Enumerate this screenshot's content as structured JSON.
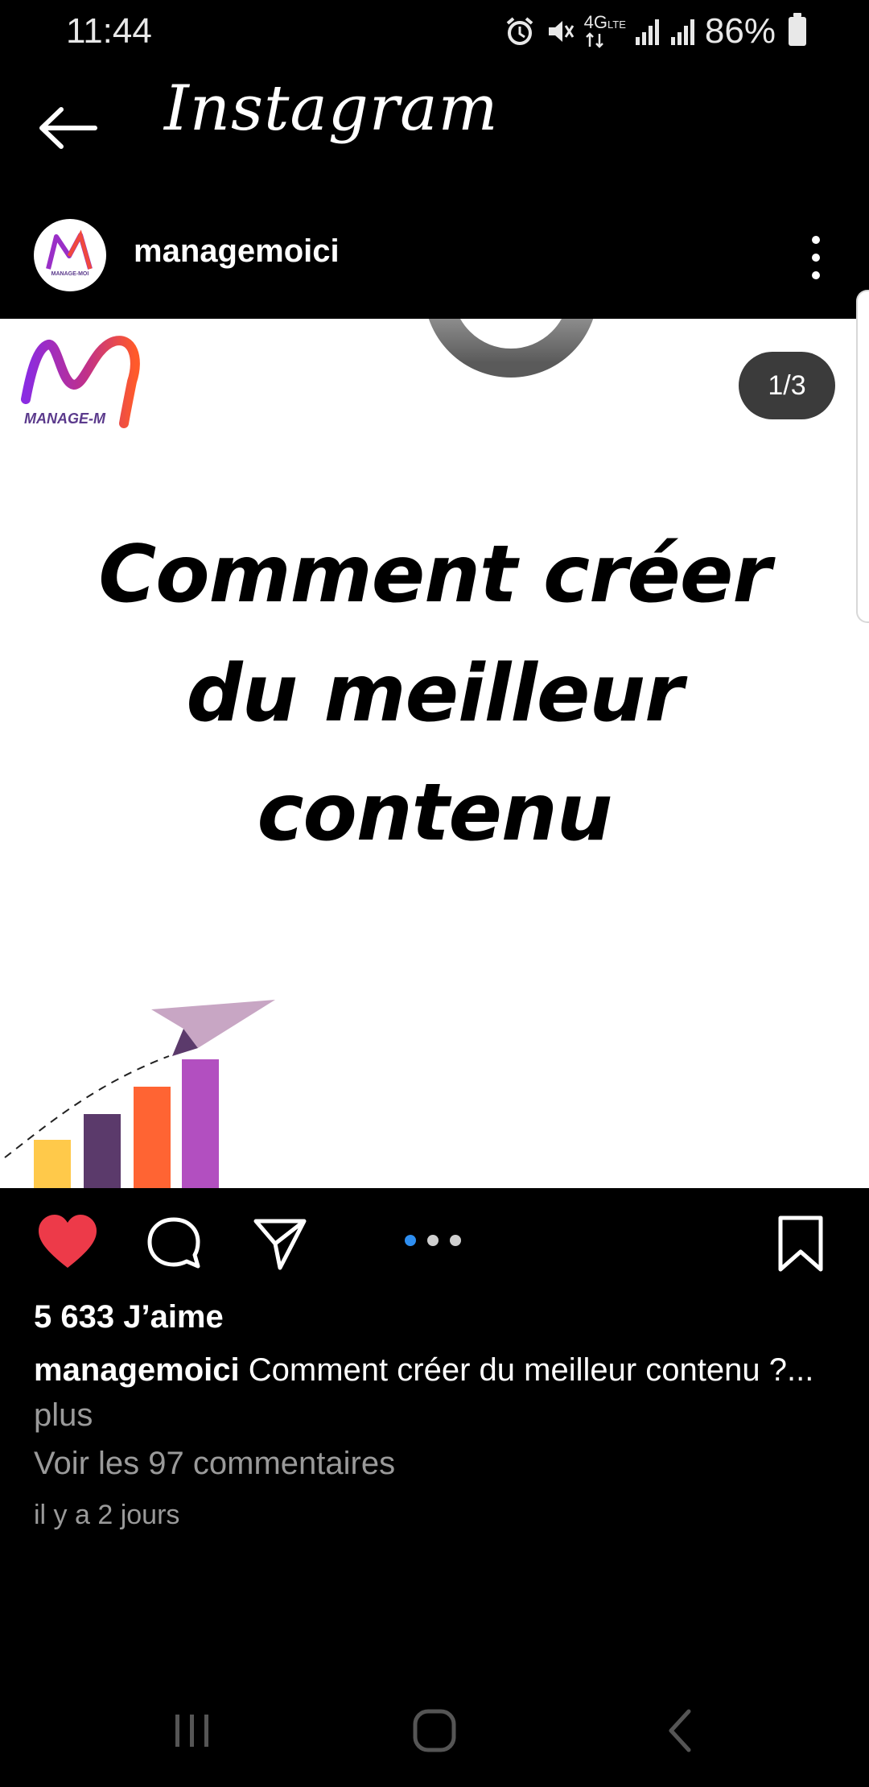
{
  "status_bar": {
    "time": "11:44",
    "network": "4G",
    "network_sub": "LTE",
    "battery": "86%",
    "icons": [
      "alarm-icon",
      "mute-icon",
      "data-arrows-icon",
      "signal-icon",
      "signal-icon",
      "battery-icon"
    ]
  },
  "header": {
    "brand": "Instagram",
    "back_icon": "back-arrow-icon"
  },
  "post": {
    "username": "managemoici",
    "avatar_logo_text": "MANAGE-MOI",
    "menu_icon": "more-vertical-icon",
    "image": {
      "logo_text": "MANAGE-M",
      "title": "Comment créer du meilleur contenu",
      "counter": "1/3",
      "chart_bars_colors": [
        "#FFC94A",
        "#5B3A6B",
        "#FF6433",
        "#B24FC0"
      ]
    },
    "carousel": {
      "count": 3,
      "active_index": 0
    },
    "actions": [
      "heart-icon",
      "comment-icon",
      "share-icon",
      "bookmark-icon"
    ],
    "likes": "5 633 J’aime",
    "caption_user": "managemoici",
    "caption_text": "Comment créer du meilleur contenu ?...",
    "caption_more": "plus",
    "view_comments": "Voir les 97 commentaires",
    "timestamp": "il y a 2 jours"
  },
  "colors": {
    "background": "#000000",
    "like_red": "#ED3A49",
    "active_dot": "#2E8EF0",
    "secondary_text": "#9A9A9A"
  },
  "nav_bar": {
    "items": [
      "recent-apps-icon",
      "home-icon",
      "back-icon"
    ]
  }
}
